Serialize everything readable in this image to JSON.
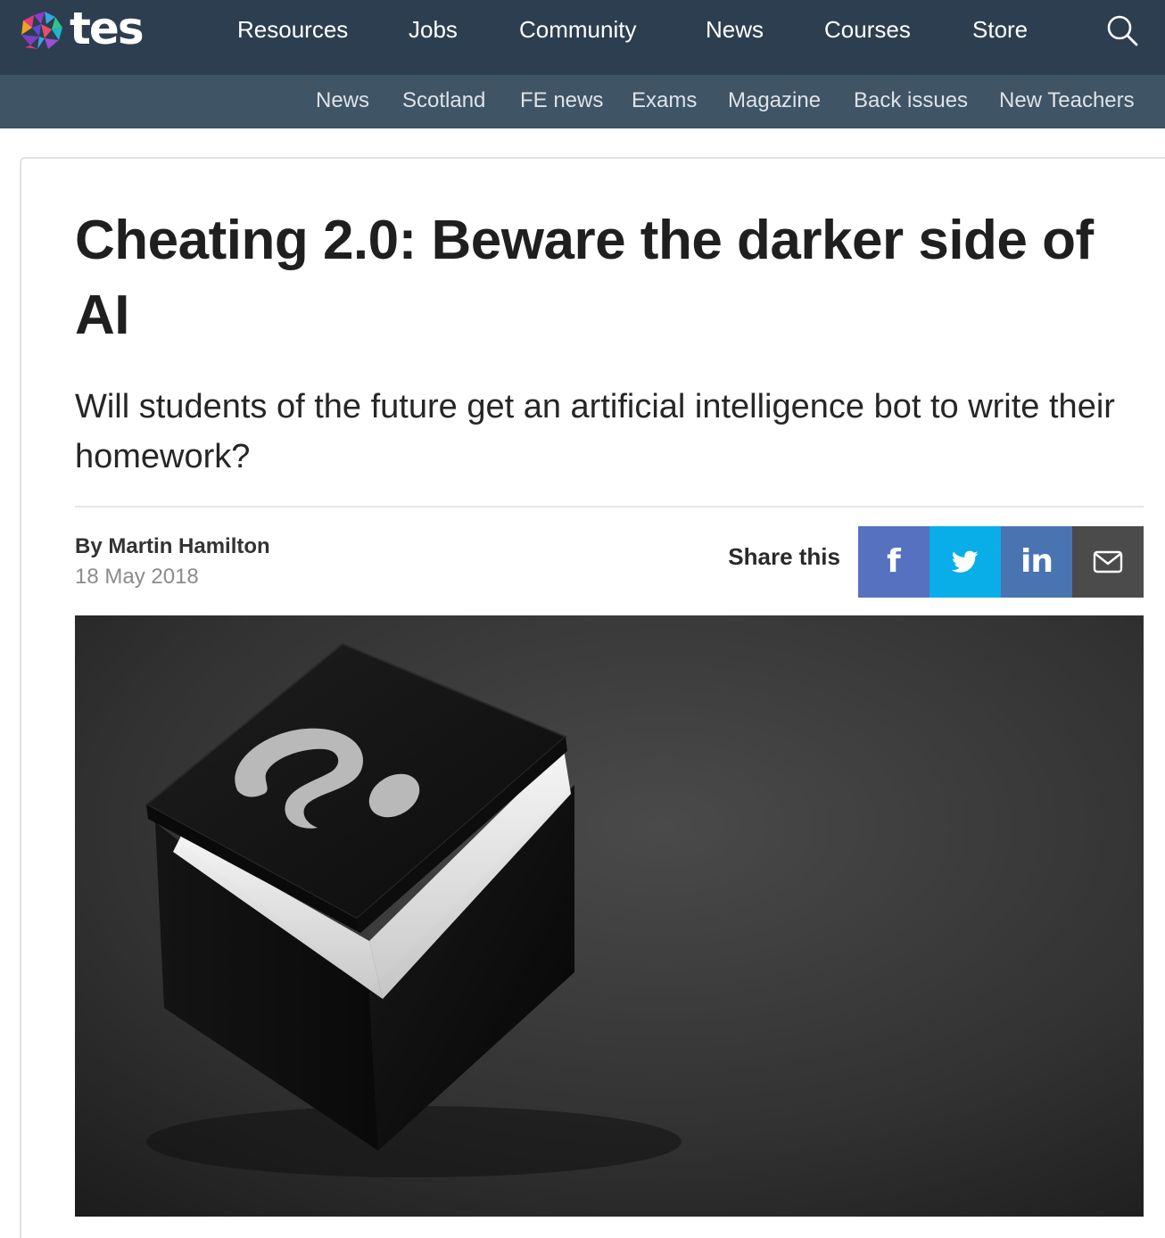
{
  "brand": {
    "name": "tes"
  },
  "main_nav": [
    {
      "label": "Resources"
    },
    {
      "label": "Jobs"
    },
    {
      "label": "Community"
    },
    {
      "label": "News"
    },
    {
      "label": "Courses"
    },
    {
      "label": "Store"
    }
  ],
  "sub_nav": [
    {
      "label": "News"
    },
    {
      "label": "Scotland"
    },
    {
      "label": "FE news"
    },
    {
      "label": "Exams"
    },
    {
      "label": "Magazine"
    },
    {
      "label": "Back issues"
    },
    {
      "label": "New Teachers"
    }
  ],
  "article": {
    "headline": "Cheating 2.0: Beware the darker side of AI",
    "standfirst": "Will students of the future get an artificial intelligence bot to write their homework?",
    "author": "By Martin Hamilton",
    "date": "18 May 2018"
  },
  "share": {
    "label": "Share this",
    "buttons": [
      {
        "network": "facebook",
        "icon": "facebook-icon",
        "glyph": "f",
        "color": "#5571c0"
      },
      {
        "network": "twitter",
        "icon": "twitter-icon",
        "color": "#09aee8"
      },
      {
        "network": "linkedin",
        "icon": "linkedin-icon",
        "glyph": "in",
        "color": "#4a73b2"
      },
      {
        "network": "email",
        "icon": "envelope-icon",
        "color": "#4b4b4b"
      }
    ]
  },
  "colors": {
    "topbar": "#2c3e50",
    "subbar": "#3f5465",
    "headline_text": "#1f1f1f",
    "date_text": "#8c8c8c"
  }
}
